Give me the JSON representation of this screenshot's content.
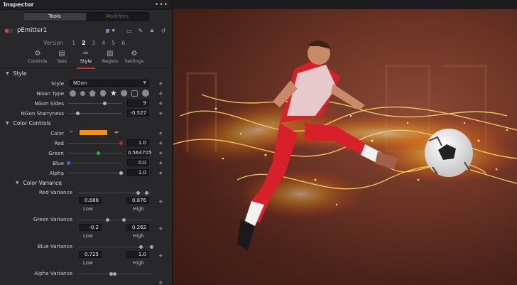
{
  "inspector": {
    "title": "Inspector",
    "menu_icon": "ellipsis-icon",
    "mode_tabs": [
      "Tools",
      "Modifiers"
    ],
    "active_mode": "Tools",
    "tool_name": "pEmitter1",
    "version_label": "Version",
    "versions": [
      "1",
      "2",
      "3",
      "4",
      "5",
      "6"
    ],
    "active_version": "2",
    "tabs": [
      {
        "label": "Controls",
        "icon": "sliders-icon"
      },
      {
        "label": "Sets",
        "icon": "sets-icon"
      },
      {
        "label": "Style",
        "icon": "brush-icon"
      },
      {
        "label": "Region",
        "icon": "region-icon"
      },
      {
        "label": "Settings",
        "icon": "gear-icon"
      }
    ],
    "active_tab": "Style",
    "style_section": "Style",
    "style_label": "Style",
    "style_value": "NGon",
    "ngon_type_label": "NGon Type",
    "ngon_sides_label": "NGon Sides",
    "ngon_sides_value": "9",
    "ngon_sides_fraction": 0.68,
    "ngon_starryness_label": "NGon Starryness",
    "ngon_starryness_value": "-0.527",
    "ngon_starryness_fraction": 0.18,
    "color_controls_section": "Color Controls",
    "color_label": "Color",
    "color_swatch": "#ff9100",
    "channels": [
      {
        "label": "Red",
        "value": "1.0",
        "fraction": 0.98,
        "thumb_color": "#e02020"
      },
      {
        "label": "Green",
        "value": "0.564705",
        "fraction": 0.56,
        "thumb_color": "#20c040"
      },
      {
        "label": "Blue",
        "value": "0.0",
        "fraction": 0.0,
        "thumb_color": "#3070e0"
      },
      {
        "label": "Alpha",
        "value": "1.0",
        "fraction": 0.98,
        "thumb_color": "#b5b5b8"
      }
    ],
    "color_variance_section": "Color Variance",
    "variances": [
      {
        "label": "Red Variance",
        "low": "0.688",
        "high": "0.876",
        "low_fraction": 0.82,
        "high_fraction": 0.94
      },
      {
        "label": "Green Variance",
        "low": "-0.2",
        "high": "0.262",
        "low_fraction": 0.4,
        "high_fraction": 0.63
      },
      {
        "label": "Blue Variance",
        "low": "0.725",
        "high": "1.0",
        "low_fraction": 0.86,
        "high_fraction": 1.0
      },
      {
        "label": "Alpha Variance",
        "low": "",
        "high": "",
        "low_fraction": 0.45,
        "high_fraction": 0.5
      }
    ],
    "low_label": "Low",
    "high_label": "High"
  },
  "viewer": {
    "content": "soccer-player-fire-image"
  }
}
